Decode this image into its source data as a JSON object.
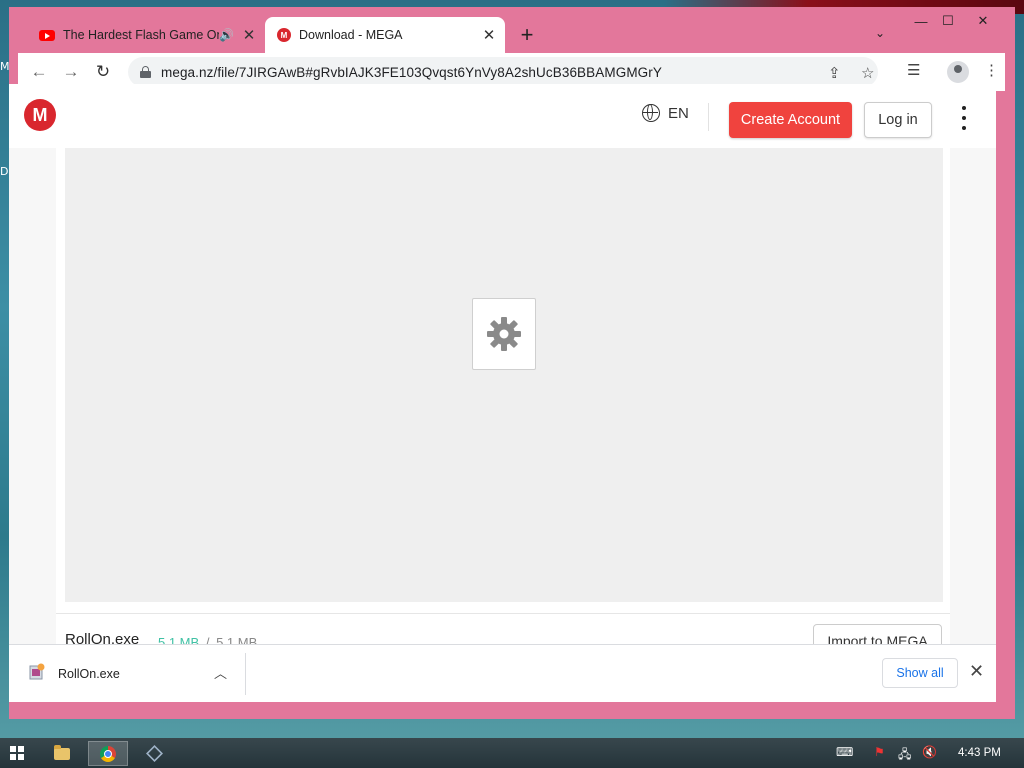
{
  "desktop": {
    "edge_labels": [
      "M",
      "D"
    ]
  },
  "browser": {
    "tabs": [
      {
        "title": "The Hardest Flash Game On",
        "active": false,
        "icon": "youtube-icon",
        "audio": true
      },
      {
        "title": "Download - MEGA",
        "active": true,
        "icon": "mega-icon"
      }
    ],
    "new_tab_label": "+",
    "url": "mega.nz/file/7JIRGAwB#gRvbIAJK3FE103Qvqst6YnVy8A2shUcB36BBAMGMGrY"
  },
  "mega": {
    "logo_letter": "M",
    "language": "EN",
    "create_account_label": "Create Account",
    "login_label": "Log in",
    "file_name": "RollOn.exe",
    "downloaded_size": "5.1 MB",
    "size_separator": "/",
    "total_size": "5.1 MB",
    "import_label": "Import to MEGA",
    "accent_color": "#d9272e",
    "button_color": "#f0433e",
    "progress_color": "#3fc1a4"
  },
  "download_shelf": {
    "file_name": "RollOn.exe",
    "show_all_label": "Show all"
  },
  "taskbar": {
    "time": "4:43 PM",
    "items": [
      "file-explorer-icon",
      "chrome-icon",
      "virtualbox-icon"
    ]
  }
}
